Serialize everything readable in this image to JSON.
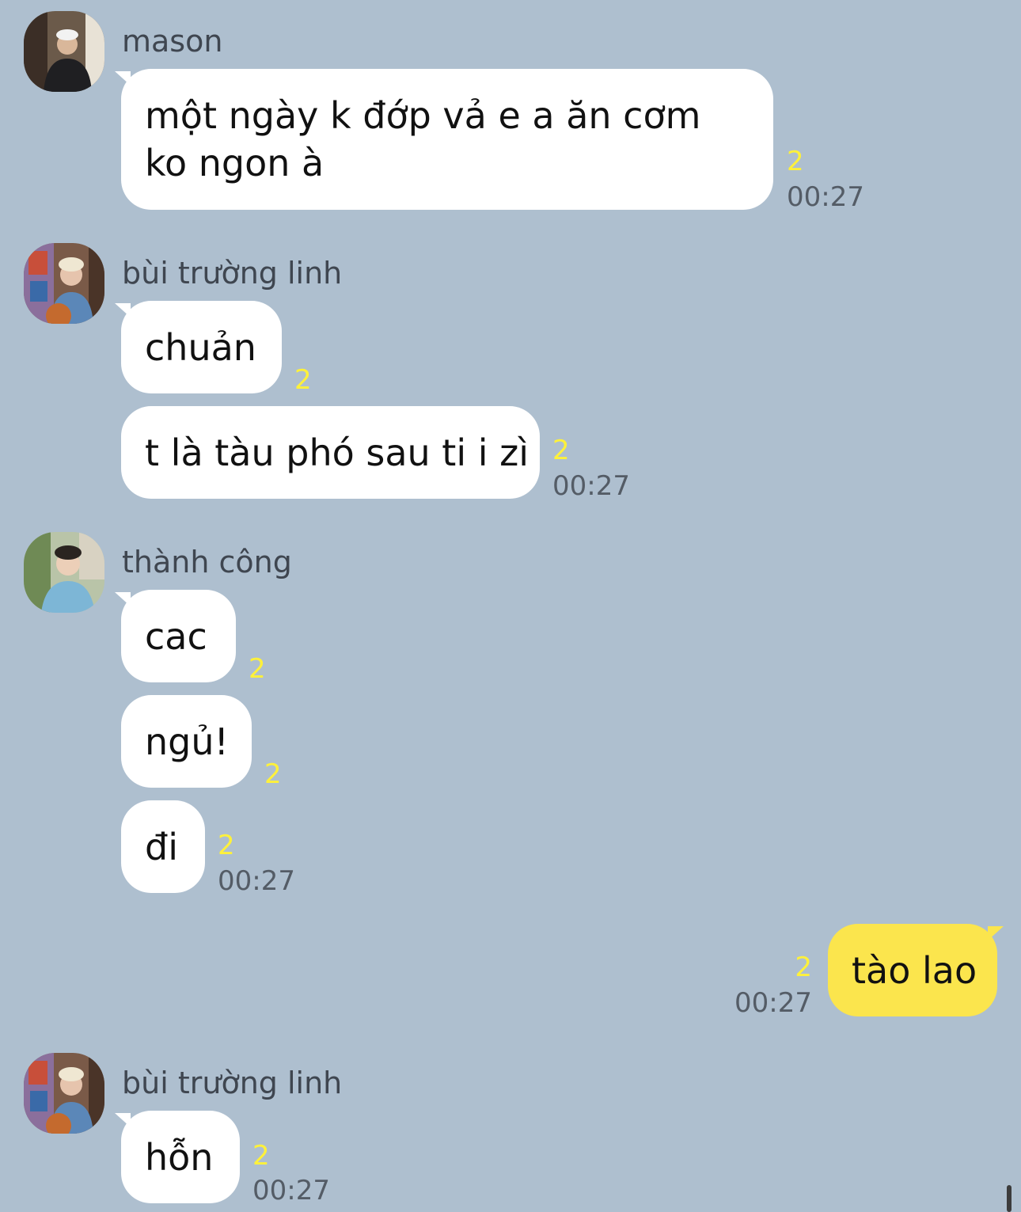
{
  "colors": {
    "background": "#aebfcf",
    "incoming_bubble": "#ffffff",
    "outgoing_bubble": "#fbe54d",
    "unread_count": "#fff13a",
    "timestamp": "#545c66"
  },
  "messages": [
    {
      "sender": "mason",
      "avatar": "avatar-mason-icon",
      "bubbles": [
        {
          "text": "một ngày k đớp vả e a ăn cơm ko ngon à",
          "count": "2",
          "time": "00:27"
        }
      ]
    },
    {
      "sender": "bùi trường linh",
      "avatar": "avatar-bui-truong-linh-icon",
      "bubbles": [
        {
          "text": "chuản",
          "count": "2"
        },
        {
          "text": "t là tàu phó sau ti i zì",
          "count": "2",
          "time": "00:27"
        }
      ]
    },
    {
      "sender": "thành công",
      "avatar": "avatar-thanh-cong-icon",
      "bubbles": [
        {
          "text": "cac",
          "count": "2"
        },
        {
          "text": "ngủ!",
          "count": "2"
        },
        {
          "text": "đi",
          "count": "2",
          "time": "00:27"
        }
      ]
    },
    {
      "sender": "me",
      "outgoing": true,
      "bubbles": [
        {
          "text": "tào lao",
          "count": "2",
          "time": "00:27"
        }
      ]
    },
    {
      "sender": "bùi trường linh",
      "avatar": "avatar-bui-truong-linh-icon",
      "bubbles": [
        {
          "text": "hỗn",
          "count": "2",
          "time": "00:27"
        }
      ]
    }
  ]
}
